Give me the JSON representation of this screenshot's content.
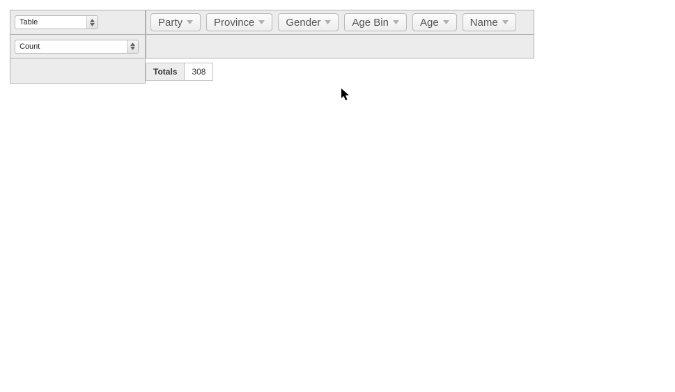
{
  "renderer": {
    "selected": "Table"
  },
  "aggregator": {
    "selected": "Count"
  },
  "unused_attrs": [
    {
      "label": "Party"
    },
    {
      "label": "Province"
    },
    {
      "label": "Gender"
    },
    {
      "label": "Age Bin"
    },
    {
      "label": "Age"
    },
    {
      "label": "Name"
    }
  ],
  "result": {
    "totals_label": "Totals",
    "totals_value": "308"
  }
}
